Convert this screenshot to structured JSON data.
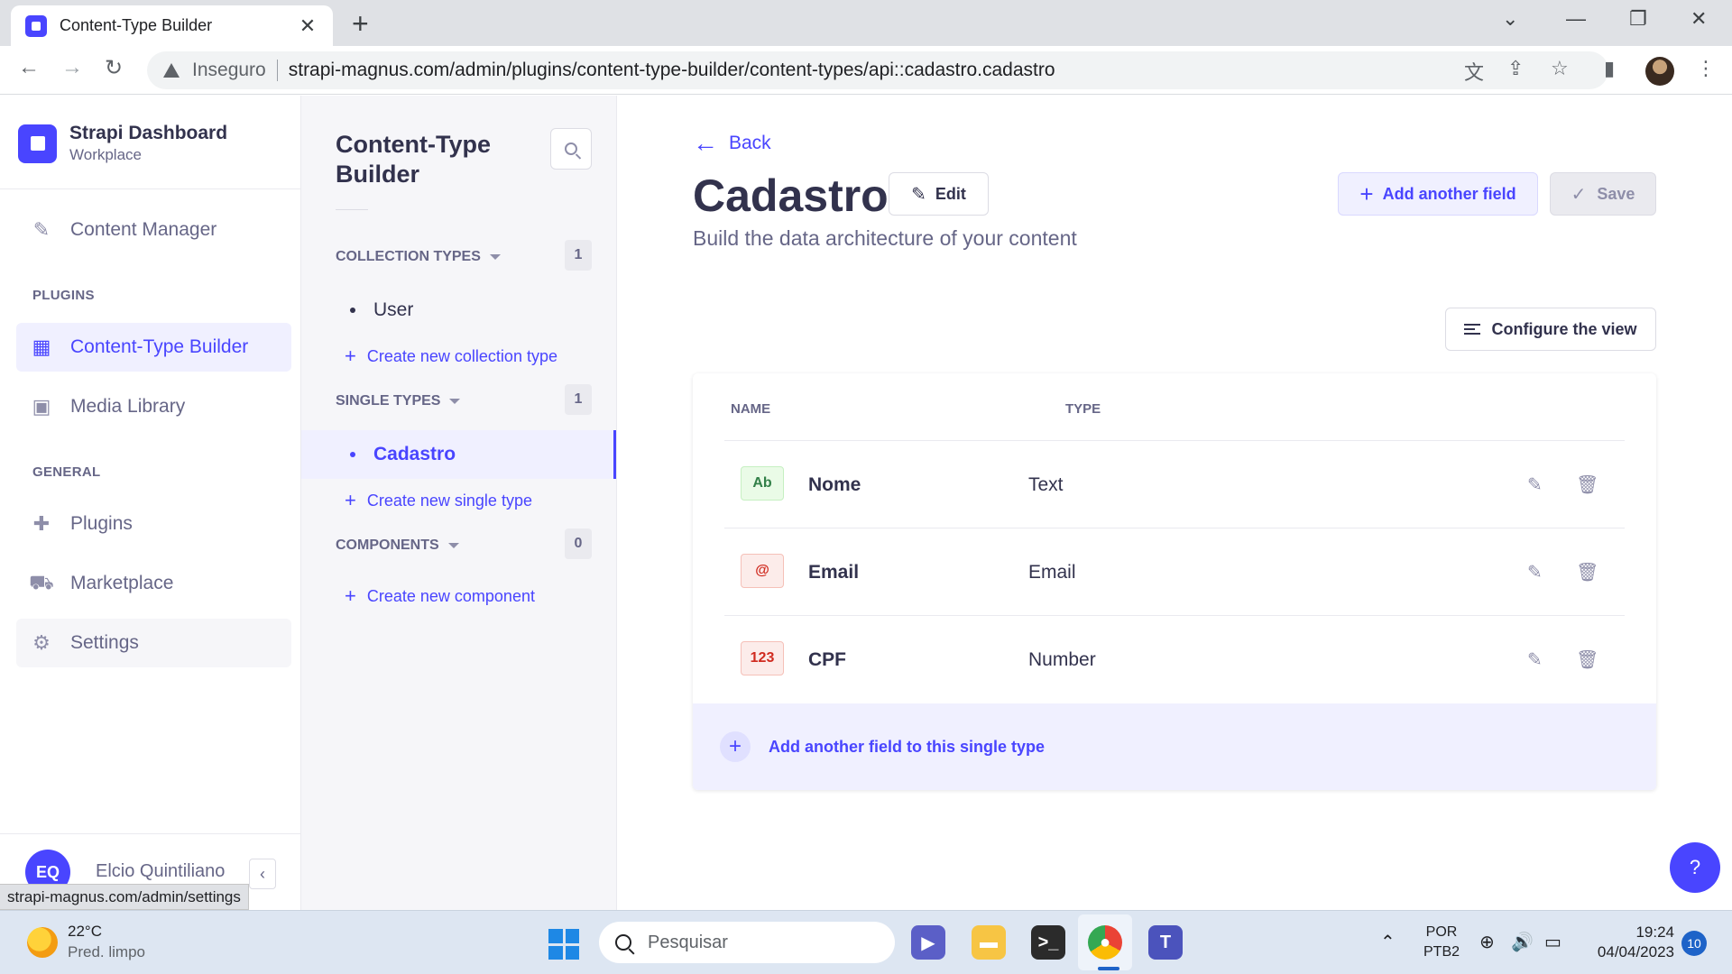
{
  "browser": {
    "tab_title": "Content-Type Builder",
    "close_glyph": "✕",
    "new_tab_glyph": "+",
    "security_label": "Inseguro",
    "url": "strapi-magnus.com/admin/plugins/content-type-builder/content-types/api::cadastro.cadastro",
    "status_url": "strapi-magnus.com/admin/settings"
  },
  "main_nav": {
    "brand_title": "Strapi Dashboard",
    "brand_subtitle": "Workplace",
    "content_manager": "Content Manager",
    "plugins_section": "PLUGINS",
    "content_type_builder": "Content-Type Builder",
    "media_library": "Media Library",
    "general_section": "GENERAL",
    "plugins": "Plugins",
    "marketplace": "Marketplace",
    "settings": "Settings",
    "user_initials": "EQ",
    "user_name": "Elcio Quintiliano"
  },
  "sub_nav": {
    "title": "Content-Type Builder",
    "collection_types": {
      "label": "COLLECTION TYPES",
      "count": "1",
      "items": [
        "User"
      ],
      "create_label": "Create new collection type"
    },
    "single_types": {
      "label": "SINGLE TYPES",
      "count": "1",
      "items": [
        "Cadastro"
      ],
      "create_label": "Create new single type"
    },
    "components": {
      "label": "COMPONENTS",
      "count": "0",
      "create_label": "Create new component"
    }
  },
  "main": {
    "back_label": "Back",
    "title": "Cadastro",
    "edit_label": "Edit",
    "subtitle": "Build the data architecture of your content",
    "add_field_label": "Add another field",
    "save_label": "Save",
    "configure_label": "Configure the view",
    "table": {
      "headers": [
        "NAME",
        "TYPE"
      ],
      "rows": [
        {
          "badge": "Ab",
          "name": "Nome",
          "type": "Text",
          "badge_color": "#328048",
          "badge_bg": "#eafbe7",
          "badge_border": "#c6f0c2"
        },
        {
          "badge": "@",
          "name": "Email",
          "type": "Email",
          "badge_color": "#d02b20",
          "badge_bg": "#fcecea",
          "badge_border": "#f5c0b8"
        },
        {
          "badge": "123",
          "name": "CPF",
          "type": "Number",
          "badge_color": "#d02b20",
          "badge_bg": "#fcecea",
          "badge_border": "#f5c0b8"
        }
      ]
    },
    "footer_add_label": "Add another field to this single type",
    "help_label": "?"
  },
  "taskbar": {
    "weather_temp": "22°C",
    "weather_desc": "Pred. limpo",
    "search_placeholder": "Pesquisar",
    "lang_top": "POR",
    "lang_bottom": "PTB2",
    "time": "19:24",
    "date": "04/04/2023",
    "notifications": "10"
  },
  "colors": {
    "accent": "#4945ff",
    "accent_light": "#f0f0ff",
    "text_primary": "#32324d",
    "text_secondary": "#666687"
  }
}
